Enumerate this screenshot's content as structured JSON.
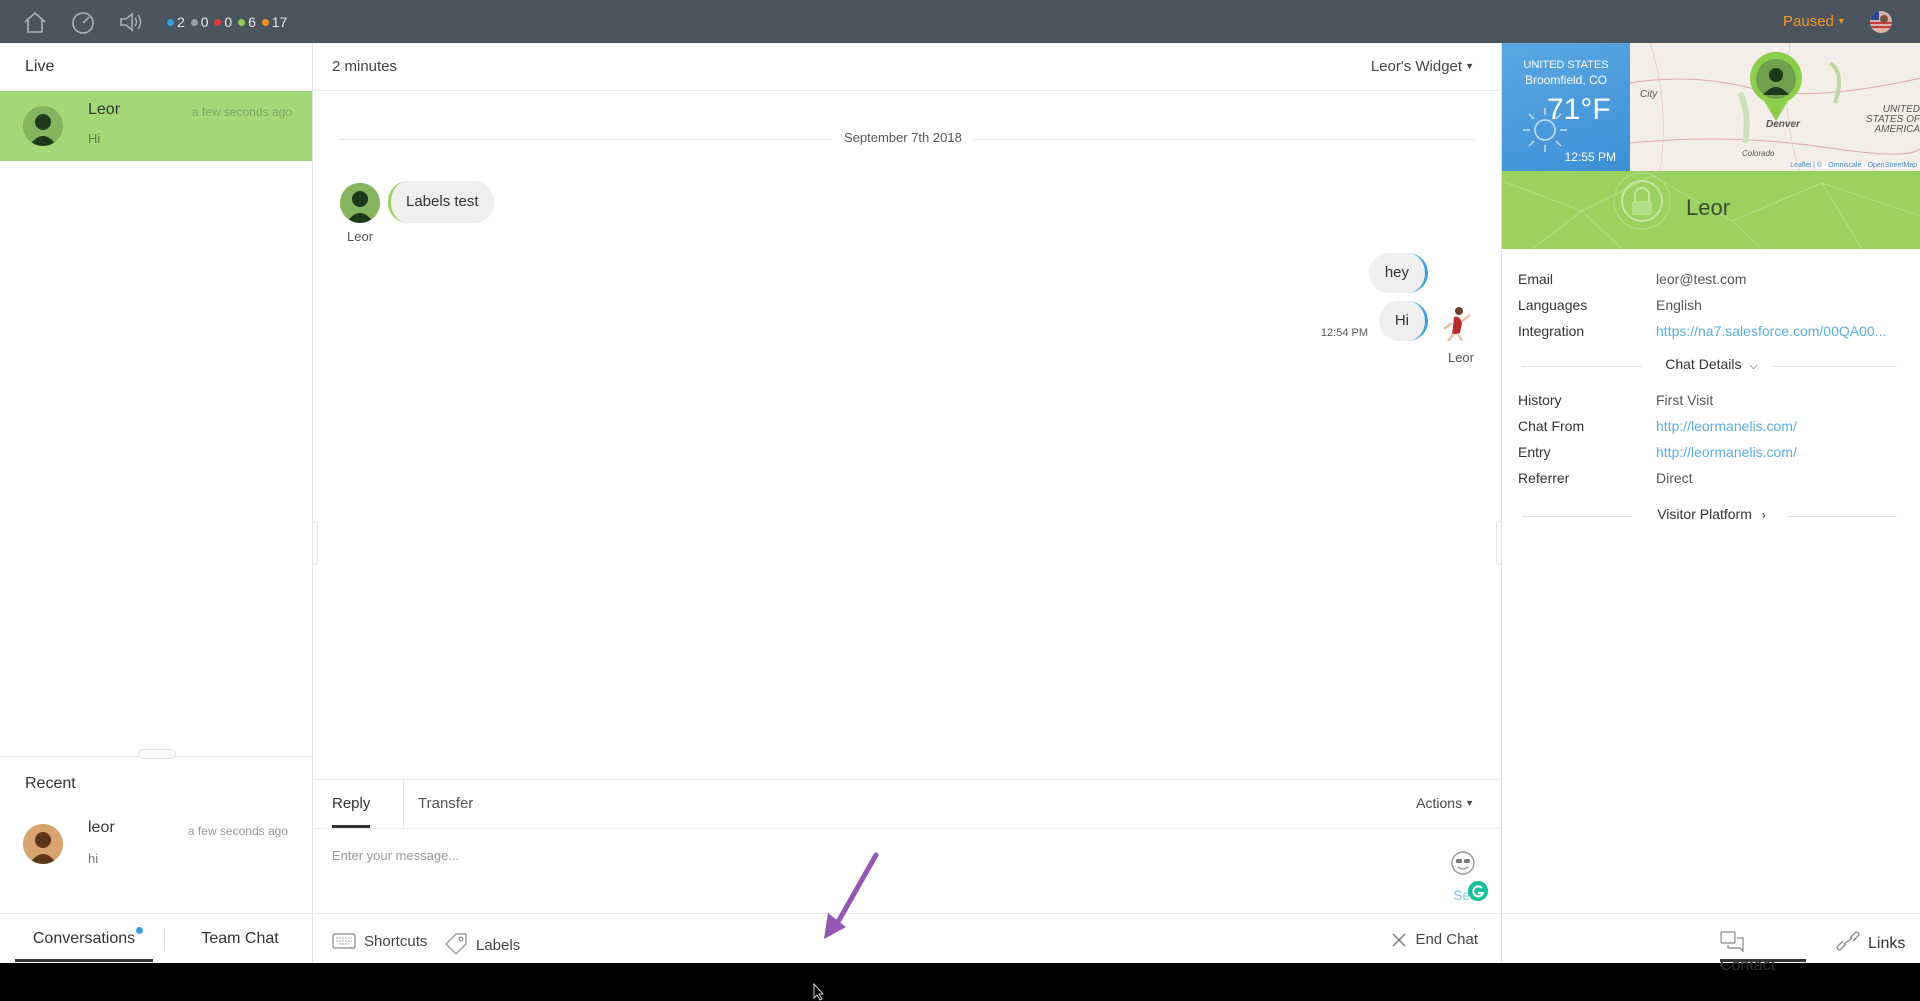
{
  "topbar": {
    "icons": [
      "home-icon",
      "dashboard-icon",
      "volume-icon"
    ],
    "counts": [
      {
        "value": "2",
        "color": "#3a9fe0"
      },
      {
        "value": "0",
        "color": "#9aa3aa"
      },
      {
        "value": "0",
        "color": "#e0423a"
      },
      {
        "value": "6",
        "color": "#8ccf4d"
      },
      {
        "value": "17",
        "color": "#f7941d"
      }
    ],
    "status": "Paused"
  },
  "left": {
    "live_header": "Live",
    "live_item": {
      "name": "Leor",
      "time": "a few seconds ago",
      "message": "Hi"
    },
    "recent_header": "Recent",
    "recent_item": {
      "name": "leor",
      "time": "a few seconds ago",
      "message": "hi"
    },
    "tabs": {
      "conversations": "Conversations",
      "team_chat": "Team Chat"
    }
  },
  "center": {
    "duration": "2 minutes",
    "widget": "Leor's Widget",
    "date": "September 7th 2018",
    "messages": [
      {
        "from": "Leor",
        "text": "Labels test",
        "side": "visitor"
      },
      {
        "text": "hey",
        "side": "agent"
      },
      {
        "text": "Hi",
        "side": "agent",
        "time": "12:54 PM",
        "from": "Leor"
      }
    ],
    "composer": {
      "tab_reply": "Reply",
      "tab_transfer": "Transfer",
      "actions": "Actions",
      "placeholder": "Enter your message...",
      "send": "Sen"
    },
    "tools": {
      "shortcuts": "Shortcuts",
      "labels": "Labels",
      "end_chat": "End Chat"
    }
  },
  "right": {
    "weather": {
      "country": "UNITED STATES",
      "city": "Broomfield, CO",
      "temp": "71°F",
      "time": "12:55 PM"
    },
    "map": {
      "labels": {
        "city": "City",
        "denver": "Denver",
        "usa": "UNITED STATES OF AMERICA",
        "colorado": "Colorado"
      },
      "attribution": "Leaflet | © · Omniscale · OpenStreetMap"
    },
    "profile_name": "Leor",
    "info": {
      "email_label": "Email",
      "email": "leor@test.com",
      "languages_label": "Languages",
      "languages": "English",
      "integration_label": "Integration",
      "integration": "https://na7.salesforce.com/00QA00..."
    },
    "chat_details_header": "Chat Details",
    "details": {
      "history_label": "History",
      "history": "First Visit",
      "chat_from_label": "Chat From",
      "chat_from": "http://leormanelis.com/",
      "entry_label": "Entry",
      "entry": "http://leormanelis.com/",
      "referrer_label": "Referrer",
      "referrer": "Direct"
    },
    "visitor_platform_header": "Visitor Platform",
    "tabs": {
      "contact": "Contact",
      "links": "Links"
    }
  },
  "colors": {
    "accent_green": "#9ad15f",
    "accent_blue": "#3a9fe0",
    "paused": "#f7941d",
    "topbar": "#4a5560"
  }
}
